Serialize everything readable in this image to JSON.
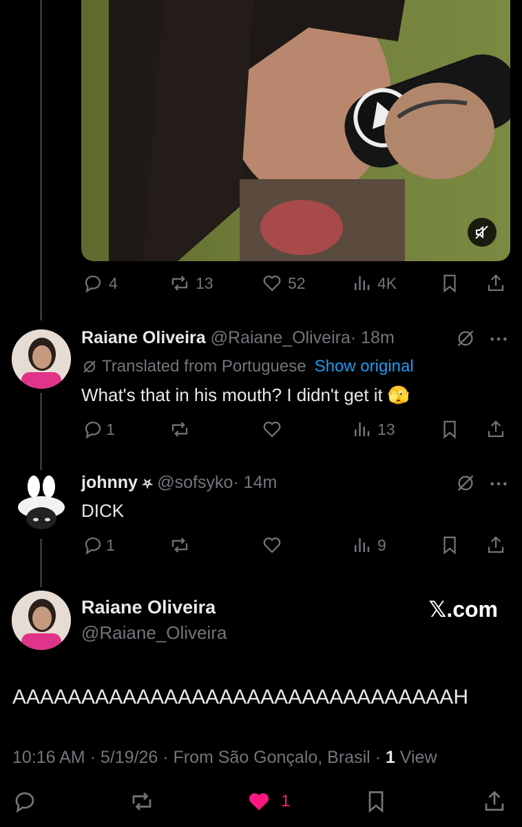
{
  "media": {
    "description_icon": "muted-speaker-icon"
  },
  "tweet1_stats": {
    "replies": "4",
    "reposts": "13",
    "likes": "52",
    "views": "4K"
  },
  "reply1": {
    "name": "Raiane Oliveira",
    "handle": "@Raiane_Oliveira",
    "time": "· 18m",
    "translated": "Translated from Portuguese",
    "show_original": "Show original",
    "text": "What's that in his mouth? I didn't get it 🫣",
    "replies": "1",
    "views": "13"
  },
  "reply2": {
    "name": "johnny",
    "name_symbol": "⛧",
    "handle": "@sofsyko",
    "time": "· 14m",
    "text": "DICK",
    "replies": "1",
    "views": "9"
  },
  "main": {
    "name": "Raiane Oliveira",
    "handle": "@Raiane_Oliveira",
    "brand": "𝕏.com",
    "text": "AAAAAAAAAAAAAAAAAAAAAAAAAAAAAAAAH",
    "meta_prefix": "10:16 AM · 5/19/26 · From São Gonçalo, Brasil · ",
    "views_count": "1",
    "views_label": " View",
    "likes": "1"
  },
  "colors": {
    "accent": "#1d9bf0",
    "like": "#f91880",
    "muted": "#71767b"
  }
}
